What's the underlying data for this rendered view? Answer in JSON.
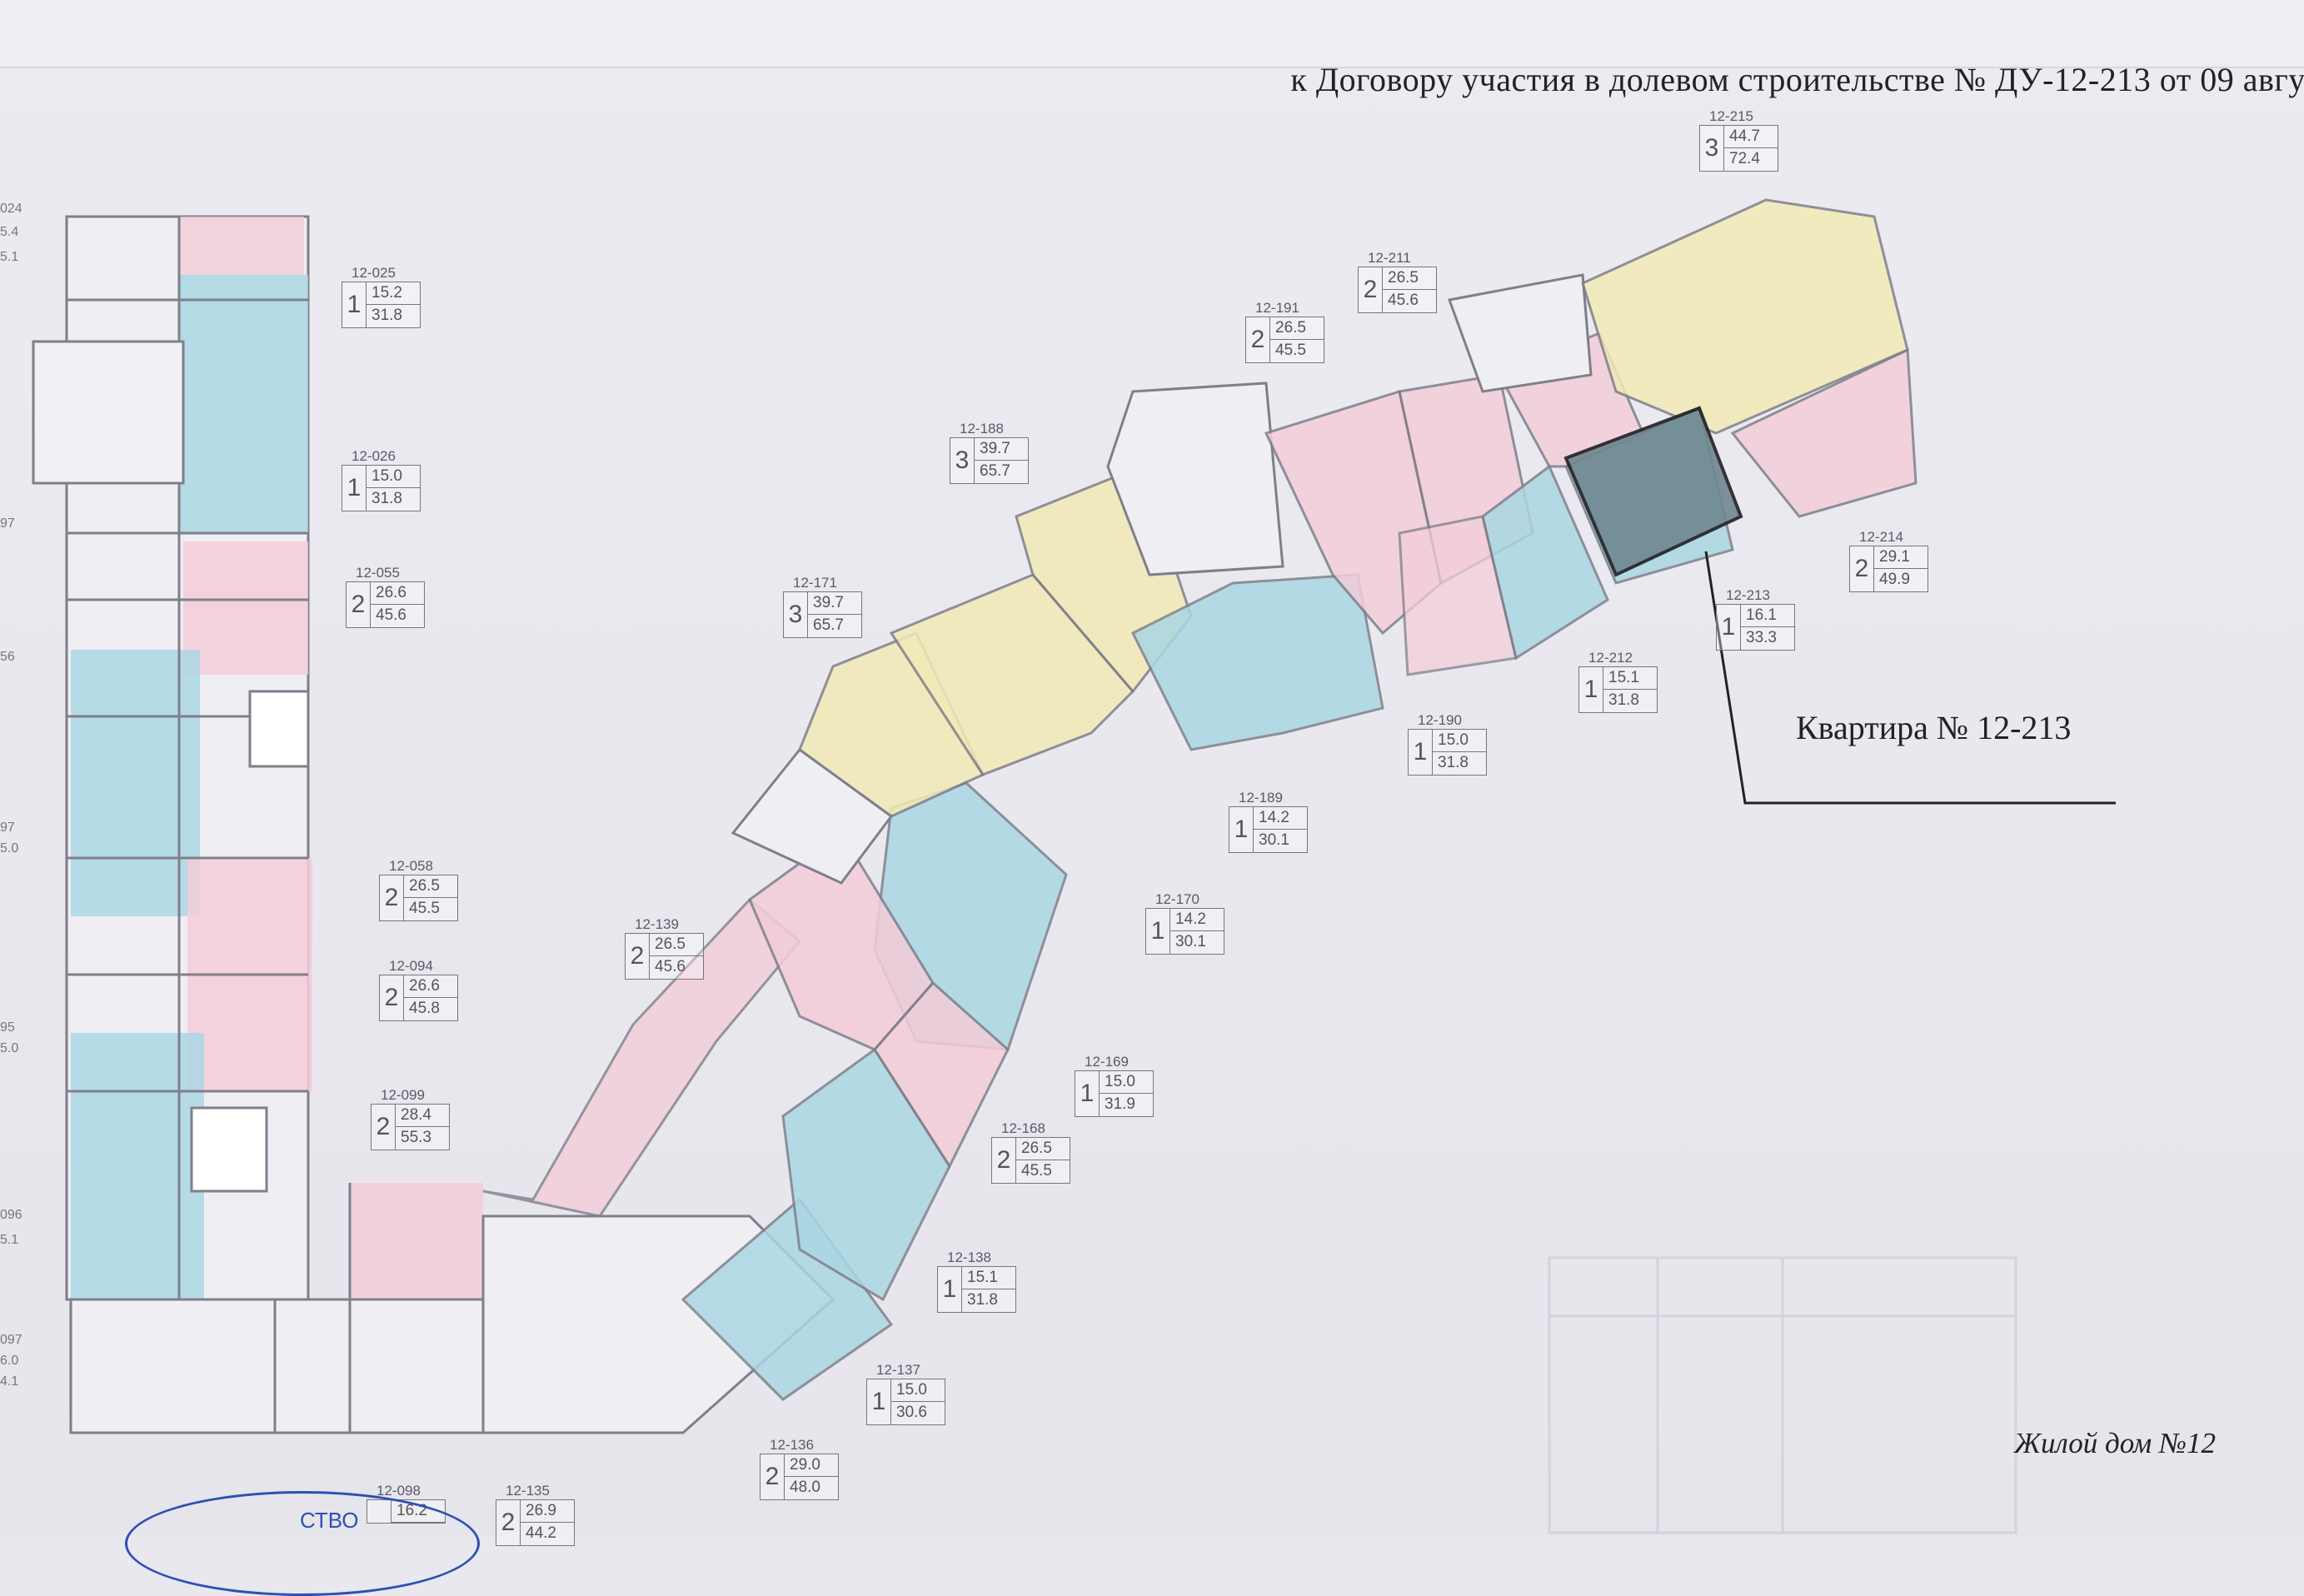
{
  "header": {
    "text": "к Договору участия в долевом строительстве № ДУ-12-213 от 09 авгус"
  },
  "callout": {
    "label": "Квартира № 12-213"
  },
  "footer": {
    "title": "Жилой дом №12"
  },
  "stamp": {
    "text": "СТВО"
  },
  "colors": {
    "one_room": "#a9d7e3",
    "two_room": "#f3cdd9",
    "three_room": "#f2eab6",
    "green_unit": "#b7e39c",
    "highlight": "#6f8790"
  },
  "units": [
    {
      "id": "12-025",
      "rooms": "1",
      "living": "15.2",
      "total": "31.8"
    },
    {
      "id": "12-026",
      "rooms": "1",
      "living": "15.0",
      "total": "31.8"
    },
    {
      "id": "12-055",
      "rooms": "2",
      "living": "26.6",
      "total": "45.6"
    },
    {
      "id": "12-058",
      "rooms": "2",
      "living": "26.5",
      "total": "45.5"
    },
    {
      "id": "12-094",
      "rooms": "2",
      "living": "26.6",
      "total": "45.8"
    },
    {
      "id": "12-099",
      "rooms": "2",
      "living": "28.4",
      "total": "55.3"
    },
    {
      "id": "12-098",
      "rooms": "",
      "living": "16.2",
      "total": ""
    },
    {
      "id": "12-135",
      "rooms": "2",
      "living": "26.9",
      "total": "44.2"
    },
    {
      "id": "12-136",
      "rooms": "2",
      "living": "29.0",
      "total": "48.0"
    },
    {
      "id": "12-137",
      "rooms": "1",
      "living": "15.0",
      "total": "30.6"
    },
    {
      "id": "12-138",
      "rooms": "1",
      "living": "15.1",
      "total": "31.8"
    },
    {
      "id": "12-139",
      "rooms": "2",
      "living": "26.5",
      "total": "45.6"
    },
    {
      "id": "12-168",
      "rooms": "2",
      "living": "26.5",
      "total": "45.5"
    },
    {
      "id": "12-169",
      "rooms": "1",
      "living": "15.0",
      "total": "31.9"
    },
    {
      "id": "12-170",
      "rooms": "1",
      "living": "14.2",
      "total": "30.1"
    },
    {
      "id": "12-171",
      "rooms": "3",
      "living": "39.7",
      "total": "65.7"
    },
    {
      "id": "12-188",
      "rooms": "3",
      "living": "39.7",
      "total": "65.7"
    },
    {
      "id": "12-189",
      "rooms": "1",
      "living": "14.2",
      "total": "30.1"
    },
    {
      "id": "12-190",
      "rooms": "1",
      "living": "15.0",
      "total": "31.8"
    },
    {
      "id": "12-191",
      "rooms": "2",
      "living": "26.5",
      "total": "45.5"
    },
    {
      "id": "12-211",
      "rooms": "2",
      "living": "26.5",
      "total": "45.6"
    },
    {
      "id": "12-212",
      "rooms": "1",
      "living": "15.1",
      "total": "31.8"
    },
    {
      "id": "12-213",
      "rooms": "1",
      "living": "16.1",
      "total": "33.3"
    },
    {
      "id": "12-214",
      "rooms": "2",
      "living": "29.1",
      "total": "49.9"
    },
    {
      "id": "12-215",
      "rooms": "3",
      "living": "44.7",
      "total": "72.4"
    }
  ],
  "edge_fragments": [
    "024",
    "5.4",
    "5.1",
    "97",
    "56",
    "97",
    "5.0",
    "95",
    "5.0",
    "096",
    "5.1",
    "097",
    "6.0",
    "4.1"
  ]
}
